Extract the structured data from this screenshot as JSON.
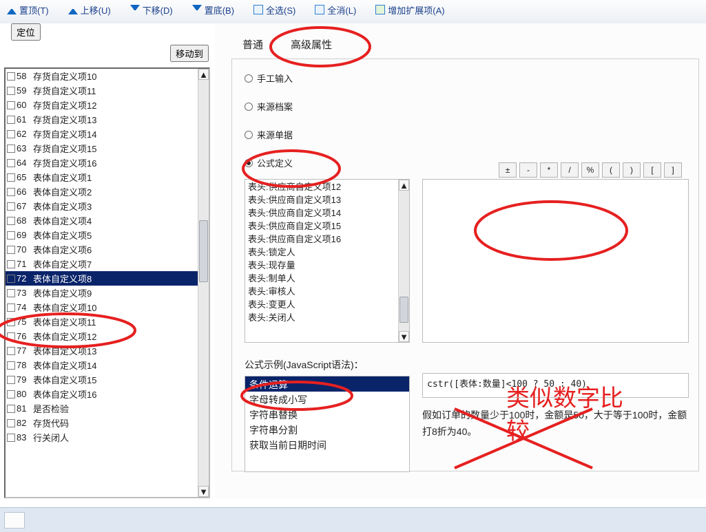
{
  "toolbar": {
    "top": "置顶(T)",
    "up": "上移(U)",
    "down": "下移(D)",
    "bottom": "置底(B)",
    "selectAll": "全选(S)",
    "selectNone": "全消(L)",
    "addExt": "增加扩展项(A)"
  },
  "leftButtons": {
    "locate": "定位",
    "moveTo": "移动到"
  },
  "leftList": [
    {
      "n": "58",
      "t": "存货自定义项10"
    },
    {
      "n": "59",
      "t": "存货自定义项11"
    },
    {
      "n": "60",
      "t": "存货自定义项12"
    },
    {
      "n": "61",
      "t": "存货自定义项13"
    },
    {
      "n": "62",
      "t": "存货自定义项14"
    },
    {
      "n": "63",
      "t": "存货自定义项15"
    },
    {
      "n": "64",
      "t": "存货自定义项16"
    },
    {
      "n": "65",
      "t": "表体自定义项1"
    },
    {
      "n": "66",
      "t": "表体自定义项2"
    },
    {
      "n": "67",
      "t": "表体自定义项3"
    },
    {
      "n": "68",
      "t": "表体自定义项4"
    },
    {
      "n": "69",
      "t": "表体自定义项5"
    },
    {
      "n": "70",
      "t": "表体自定义项6"
    },
    {
      "n": "71",
      "t": "表体自定义项7"
    },
    {
      "n": "72",
      "t": "表体自定义项8"
    },
    {
      "n": "73",
      "t": "表体自定义项9"
    },
    {
      "n": "74",
      "t": "表体自定义项10"
    },
    {
      "n": "75",
      "t": "表体自定义项11"
    },
    {
      "n": "76",
      "t": "表体自定义项12"
    },
    {
      "n": "77",
      "t": "表体自定义项13"
    },
    {
      "n": "78",
      "t": "表体自定义项14"
    },
    {
      "n": "79",
      "t": "表体自定义项15"
    },
    {
      "n": "80",
      "t": "表体自定义项16"
    },
    {
      "n": "81",
      "t": "是否检验"
    },
    {
      "n": "82",
      "t": "存货代码"
    },
    {
      "n": "83",
      "t": "行关闭人"
    }
  ],
  "leftSelectedIndex": 14,
  "tabs": {
    "normal": "普通",
    "advanced": "高级属性"
  },
  "radios": {
    "manual": "手工输入",
    "archive": "来源档案",
    "bill": "来源单据",
    "formula": "公式定义"
  },
  "ops": [
    "±",
    "-",
    "*",
    "/",
    "%",
    "(",
    ")",
    "[",
    "]"
  ],
  "fieldList": [
    "表头:供应商自定义项12",
    "表头:供应商自定义项13",
    "表头:供应商自定义项14",
    "表头:供应商自定义项15",
    "表头:供应商自定义项16",
    "表头:锁定人",
    "表头:现存量",
    "表头:制单人",
    "表头:审核人",
    "表头:变更人",
    "表头:关闭人"
  ],
  "exampleLabel": "公式示例(JavaScript语法)：",
  "exampleList": [
    "条件运算",
    "字母转成小写",
    "字符串替换",
    "字符串分割",
    "获取当前日期时间"
  ],
  "exampleSelectedIndex": 0,
  "exampleCode": "cstr([表体:数量]<100 ? 50 : 40)",
  "exampleDesc": "假如订单的数量少于100时，金额是50，大于等于100时，金额打8折为40。",
  "anno": {
    "text1": "类似数字比",
    "text2": "较"
  }
}
